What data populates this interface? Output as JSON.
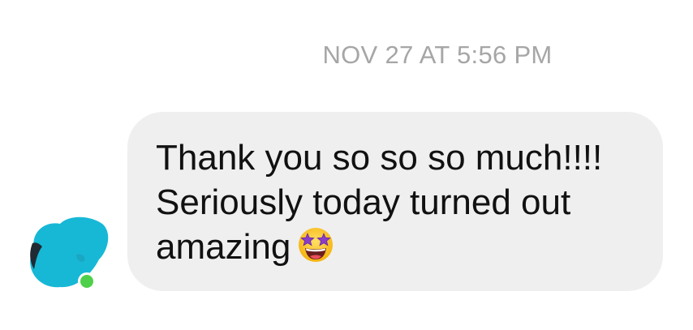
{
  "conversation": {
    "timestamp": "NOV 27 AT 5:56 PM",
    "message": {
      "lines": [
        "Thank you so so so much!!!!",
        "Seriously today turned out",
        "amazing"
      ],
      "emoji": "star-struck-emoji"
    },
    "sender": {
      "avatar_icon": "avatar-icon",
      "online_status": "online",
      "online_color": "#4fd04a"
    },
    "colors": {
      "bubble": "#efefef",
      "timestamp": "#a6a6a6",
      "text": "#111111"
    }
  }
}
